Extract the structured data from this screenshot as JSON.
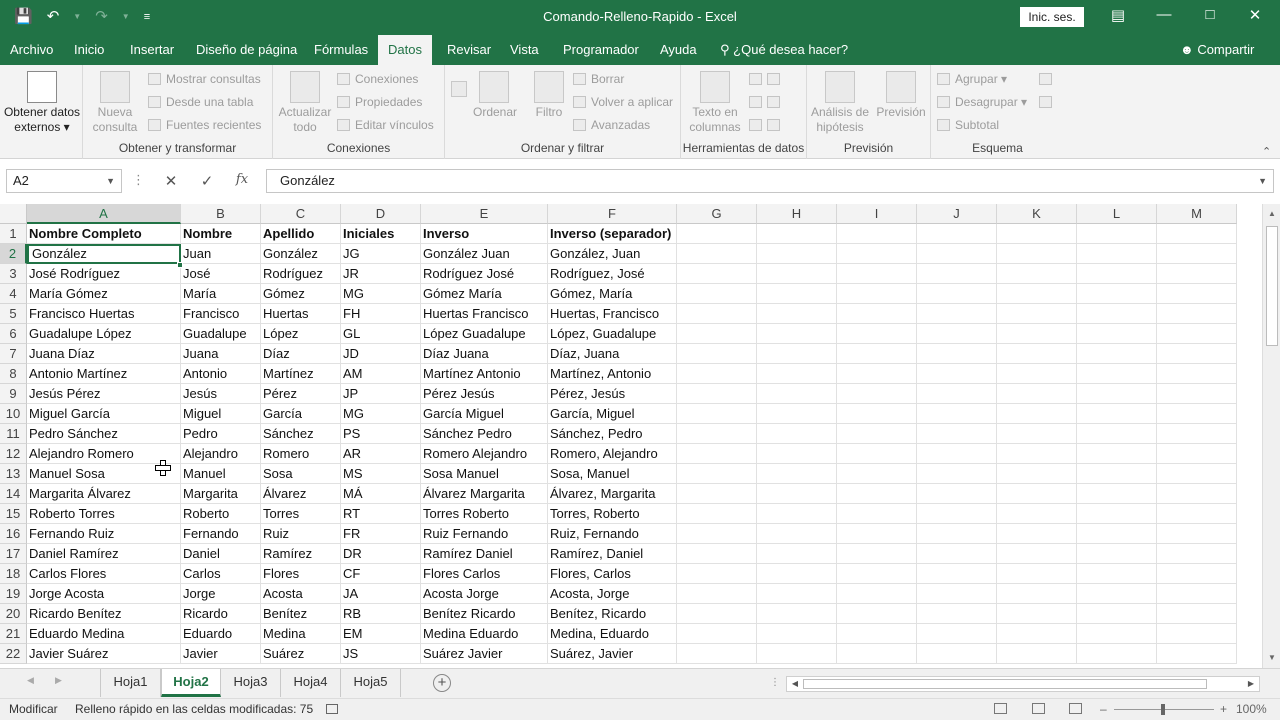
{
  "window": {
    "title": "Comando-Relleno-Rapido - Excel",
    "signin_label": "Inic. ses.",
    "icons": [
      "save-icon",
      "undo-icon",
      "redo-icon",
      "customize-qat-icon",
      "ribbon-display-icon",
      "minimize-icon",
      "maximize-icon",
      "close-icon"
    ]
  },
  "menu": {
    "tabs": [
      "Archivo",
      "Inicio",
      "Insertar",
      "Diseño de página",
      "Fórmulas",
      "Datos",
      "Revisar",
      "Vista",
      "Programador",
      "Ayuda"
    ],
    "active_tab": "Datos",
    "tellme": "¿Qué desea hacer?",
    "share": "Compartir"
  },
  "ribbon": {
    "get_external": "Obtener datos externos",
    "get_transform": {
      "label": "Obtener y transformar",
      "new_query": "Nueva consulta",
      "show_queries": "Mostrar consultas",
      "from_table": "Desde una tabla",
      "recent_sources": "Fuentes recientes"
    },
    "connections": {
      "label": "Conexiones",
      "refresh_all": "Actualizar todo",
      "connections": "Conexiones",
      "properties": "Propiedades",
      "edit_links": "Editar vínculos"
    },
    "sort_filter": {
      "label": "Ordenar y filtrar",
      "sort": "Ordenar",
      "filter": "Filtro",
      "clear": "Borrar",
      "reapply": "Volver a aplicar",
      "advanced": "Avanzadas"
    },
    "data_tools": {
      "label": "Herramientas de datos",
      "text_to_columns": "Texto en columnas"
    },
    "forecast": {
      "label": "Previsión",
      "what_if": "Análisis de hipótesis",
      "forecast_sheet": "Previsión"
    },
    "outline": {
      "label": "Esquema",
      "group": "Agrupar",
      "ungroup": "Desagrupar",
      "subtotal": "Subtotal"
    }
  },
  "formula_bar": {
    "name_box": "A2",
    "formula": "González"
  },
  "grid": {
    "columns": [
      "A",
      "B",
      "C",
      "D",
      "E",
      "F",
      "G",
      "H",
      "I",
      "J",
      "K",
      "L",
      "M"
    ],
    "row_numbers": [
      "1",
      "2",
      "3",
      "4",
      "5",
      "6",
      "7",
      "8",
      "9",
      "10",
      "11",
      "12",
      "13",
      "14",
      "15",
      "16",
      "17",
      "18",
      "19",
      "20",
      "21",
      "22"
    ],
    "rows": [
      [
        "Nombre Completo",
        "Nombre",
        "Apellido",
        "Iniciales",
        "Inverso",
        "Inverso (separador)"
      ],
      [
        "González",
        "Juan",
        "González",
        "JG",
        "González Juan",
        "González, Juan"
      ],
      [
        "José Rodríguez",
        "José",
        "Rodríguez",
        "JR",
        "Rodríguez José",
        "Rodríguez, José"
      ],
      [
        "María Gómez",
        "María",
        "Gómez",
        "MG",
        "Gómez María",
        "Gómez, María"
      ],
      [
        "Francisco Huertas",
        "Francisco",
        "Huertas",
        "FH",
        "Huertas Francisco",
        "Huertas, Francisco"
      ],
      [
        "Guadalupe López",
        "Guadalupe",
        "López",
        "GL",
        "López Guadalupe",
        "López, Guadalupe"
      ],
      [
        "Juana Díaz",
        "Juana",
        "Díaz",
        "JD",
        "Díaz Juana",
        "Díaz, Juana"
      ],
      [
        "Antonio Martínez",
        "Antonio",
        "Martínez",
        "AM",
        "Martínez Antonio",
        "Martínez, Antonio"
      ],
      [
        "Jesús Pérez",
        "Jesús",
        "Pérez",
        "JP",
        "Pérez Jesús",
        "Pérez, Jesús"
      ],
      [
        "Miguel García",
        "Miguel",
        "García",
        "MG",
        "García Miguel",
        "García, Miguel"
      ],
      [
        "Pedro Sánchez",
        "Pedro",
        "Sánchez",
        "PS",
        "Sánchez Pedro",
        "Sánchez, Pedro"
      ],
      [
        "Alejandro Romero",
        "Alejandro",
        "Romero",
        "AR",
        "Romero Alejandro",
        "Romero, Alejandro"
      ],
      [
        "Manuel Sosa",
        "Manuel",
        "Sosa",
        "MS",
        "Sosa Manuel",
        "Sosa, Manuel"
      ],
      [
        "Margarita Álvarez",
        "Margarita",
        "Álvarez",
        "MÁ",
        "Álvarez Margarita",
        "Álvarez, Margarita"
      ],
      [
        "Roberto Torres",
        "Roberto",
        "Torres",
        "RT",
        "Torres Roberto",
        "Torres, Roberto"
      ],
      [
        "Fernando Ruiz",
        "Fernando",
        "Ruiz",
        "FR",
        "Ruiz Fernando",
        "Ruiz, Fernando"
      ],
      [
        "Daniel Ramírez",
        "Daniel",
        "Ramírez",
        "DR",
        "Ramírez Daniel",
        "Ramírez, Daniel"
      ],
      [
        "Carlos Flores",
        "Carlos",
        "Flores",
        "CF",
        "Flores Carlos",
        "Flores, Carlos"
      ],
      [
        "Jorge Acosta",
        "Jorge",
        "Acosta",
        "JA",
        "Acosta Jorge",
        "Acosta, Jorge"
      ],
      [
        "Ricardo Benítez",
        "Ricardo",
        "Benítez",
        "RB",
        "Benítez Ricardo",
        "Benítez, Ricardo"
      ],
      [
        "Eduardo Medina",
        "Eduardo",
        "Medina",
        "EM",
        "Medina Eduardo",
        "Medina, Eduardo"
      ],
      [
        "Javier Suárez",
        "Javier",
        "Suárez",
        "JS",
        "Suárez Javier",
        "Suárez, Javier"
      ]
    ]
  },
  "sheets": {
    "tabs": [
      "Hoja1",
      "Hoja2",
      "Hoja3",
      "Hoja4",
      "Hoja5"
    ],
    "active": "Hoja2"
  },
  "status": {
    "mode": "Modificar",
    "message": "Relleno rápido en  las celdas modificadas: 75",
    "zoom": "100%"
  },
  "colors": {
    "accent": "#217346",
    "ribbon_bg": "#f3f3f3",
    "header_bg": "#f3f3f3"
  }
}
